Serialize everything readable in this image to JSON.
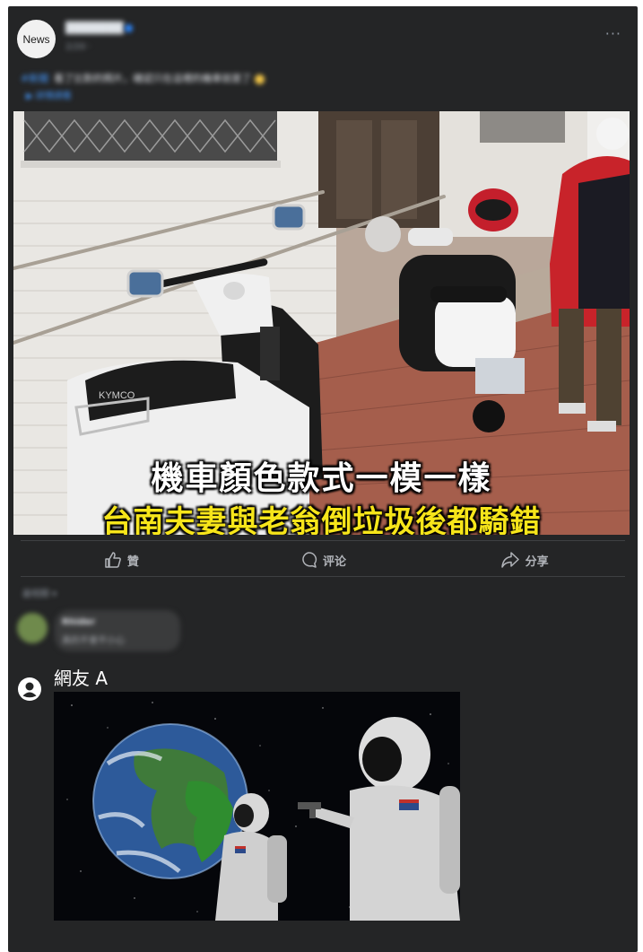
{
  "post": {
    "avatar_text": "News",
    "page_name": "███████",
    "meta": "2/20 ·",
    "caption_tag": "#新聞",
    "caption_text": "看了比對的照片，確認只在這裡的機車就是了",
    "caption_link": "▶ 詳情請看",
    "photo": {
      "overlay_line1": "機車顏色款式一模一樣",
      "overlay_line2": "台南夫妻與老翁倒垃圾後都騎錯",
      "scooter_brand": "KYMCO"
    }
  },
  "actions": {
    "like_label": "贊",
    "comment_label": "评论",
    "share_label": "分享"
  },
  "comments": {
    "sort_label": "最相關 ▾",
    "first_comment": {
      "name": "Rhider",
      "text": "真的不會不小心"
    }
  },
  "reply": {
    "name": "網友 A",
    "meme_alt": "astronaut meme"
  },
  "colors": {
    "background": "#242526",
    "text_primary": "#e4e6eb",
    "text_secondary": "#b0b3b8",
    "accent": "#2d88ff",
    "overlay_yellow": "#f6e51a"
  }
}
